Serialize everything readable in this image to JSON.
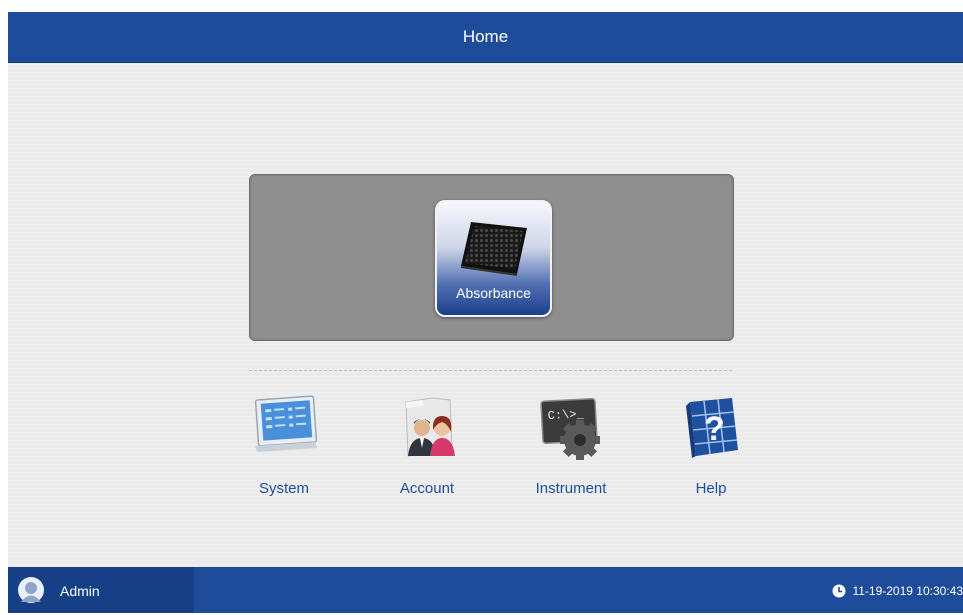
{
  "header": {
    "title": "Home"
  },
  "main": {
    "primary_button": {
      "label": "Absorbance",
      "icon": "microplate-icon"
    },
    "apps": [
      {
        "label": "System",
        "icon": "system-settings-icon"
      },
      {
        "label": "Account",
        "icon": "account-users-icon"
      },
      {
        "label": "Instrument",
        "icon": "instrument-terminal-gear-icon"
      },
      {
        "label": "Help",
        "icon": "help-icon"
      }
    ]
  },
  "footer": {
    "user": "Admin",
    "datetime": "11-19-2019 10:30:43"
  },
  "colors": {
    "bar": "#1e4b9a",
    "user_box": "#163f86",
    "background": "#ebebeb",
    "panel": "#8f8f8f",
    "link_text": "#1f4e9c"
  }
}
